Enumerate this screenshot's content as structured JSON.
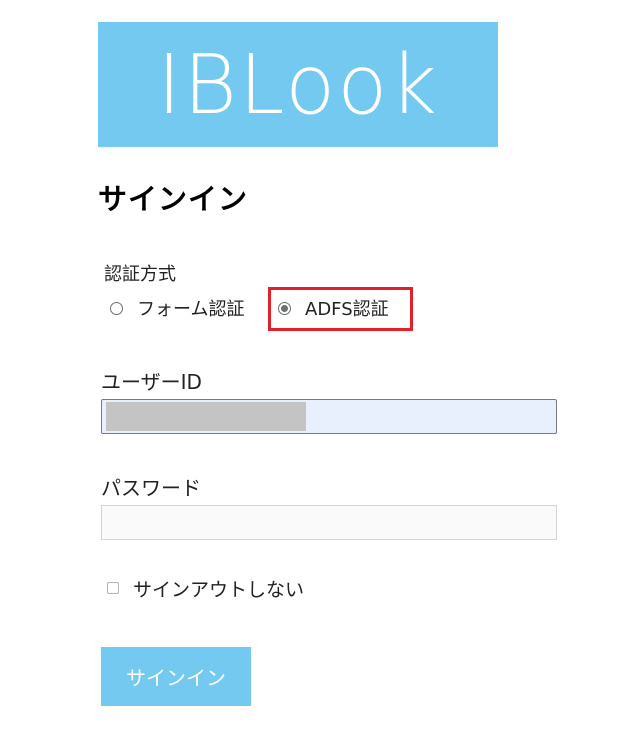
{
  "logo": {
    "text": "IBLook",
    "bg_color": "#74c9f0"
  },
  "page": {
    "title": "サインイン"
  },
  "auth": {
    "label": "認証方式",
    "options": [
      {
        "label": "フォーム認証",
        "selected": false
      },
      {
        "label": "ADFS認証",
        "selected": true
      }
    ],
    "highlight_color": "#e0202b"
  },
  "userid": {
    "label": "ユーザーID",
    "value": "",
    "value_redacted": true
  },
  "password": {
    "label": "パスワード",
    "value": ""
  },
  "remember": {
    "label": "サインアウトしない",
    "checked": false
  },
  "submit": {
    "label": "サインイン",
    "bg_color": "#74c9f0"
  }
}
